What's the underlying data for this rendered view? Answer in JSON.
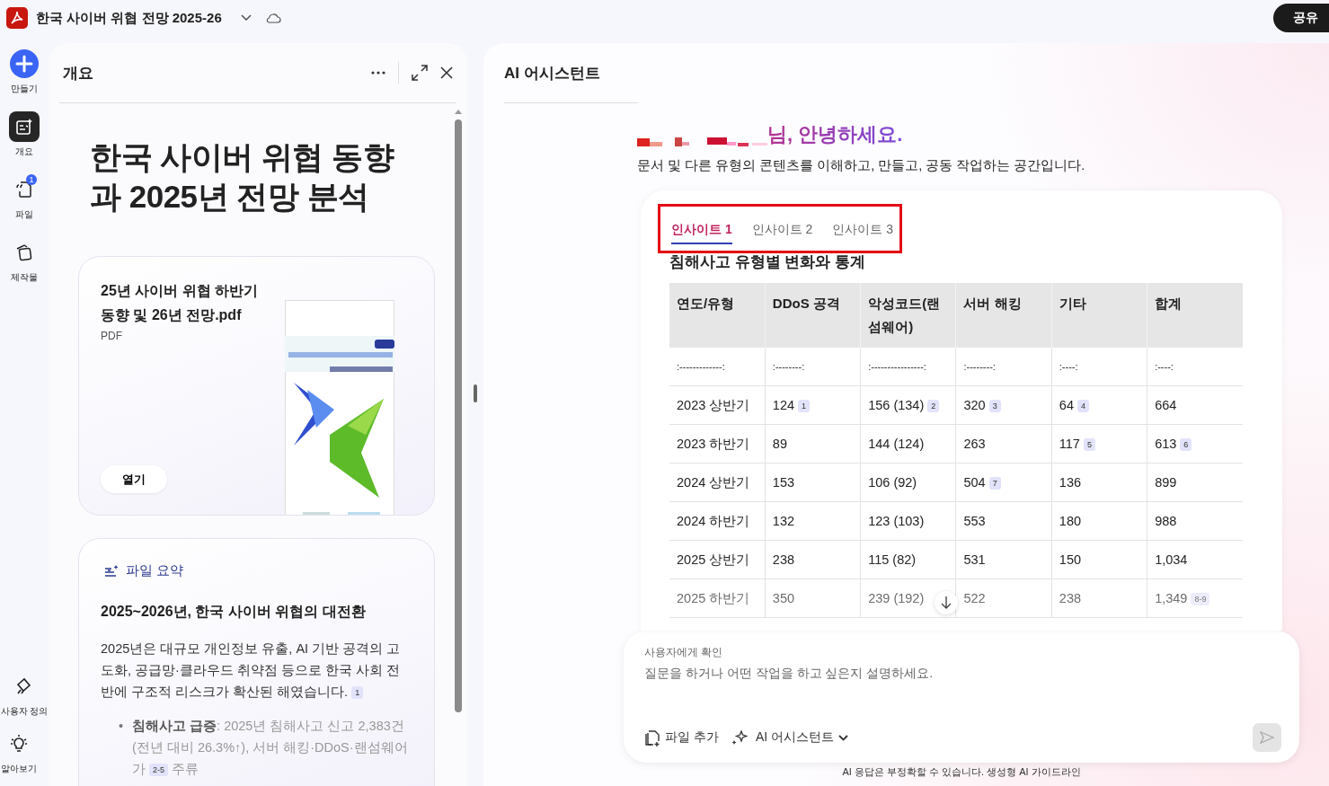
{
  "app": {
    "title": "한국 사이버 위협 전망 2025-26",
    "share_button": "공유"
  },
  "rail": {
    "top": [
      {
        "kind": "create",
        "label": "만들기",
        "selected": false
      },
      {
        "kind": "overview",
        "label": "개요",
        "selected": true
      },
      {
        "kind": "files",
        "label": "파일",
        "selected": false,
        "badge": "1"
      },
      {
        "kind": "outputs",
        "label": "제작물",
        "selected": false
      }
    ],
    "bottom": [
      {
        "kind": "customize",
        "label": "사용자 정의",
        "selected": false
      },
      {
        "kind": "learn",
        "label": "알아보기",
        "selected": false
      }
    ]
  },
  "overview": {
    "title": "개요",
    "heading": "한국 사이버 위협 동향과 2025년 전망 분석",
    "file_card": {
      "name": "25년 사이버 위협 하반기 동향 및 26년 전망.pdf",
      "type": "PDF",
      "open_button": "열기"
    },
    "summary": {
      "label": "파일 요약",
      "heading": "2025~2026년, 한국 사이버 위협의 대전환",
      "paragraph": {
        "text": "2025년은 대규모 개인정보 유출, AI 기반 공격의 고도화, 공급망·클라우드 취약점 등으로 한국 사회 전반에 구조적 리스크가 확산된 해였습니다.",
        "cite": "1"
      },
      "bullets": [
        {
          "marker": "•",
          "text": "**침해사고 급증**: 2025년 침해사고 신고 2,383건 (전년 대비 26.3%↑), 서버 해킹·DDoS·랜섬웨어가",
          "cite": "2-5",
          "tail": "주류"
        }
      ]
    }
  },
  "assistant": {
    "title": "AI 어시스턴트",
    "greeting": "님, 안녕하세요.",
    "intro": "문서 및 다른 유형의 콘텐츠를 이해하고, 만들고, 공동 작업하는 공간입니다.",
    "tabs": [
      {
        "label": "인사이트 1",
        "selected": true
      },
      {
        "label": "인사이트 2",
        "selected": false
      },
      {
        "label": "인사이트 3",
        "selected": false
      }
    ],
    "section_title": "침해사고 유형별 변화와 통계",
    "table": {
      "columns": [
        "연도/유형",
        "DDoS 공격",
        "악성코드(랜섬웨어)",
        "서버 해킹",
        "기타",
        "합계"
      ],
      "rows": [
        [
          {
            "text": ":-------------:"
          },
          {
            "text": ":--------:"
          },
          {
            "text": ":----------------:"
          },
          {
            "text": ":--------:"
          },
          {
            "text": ":----:"
          },
          {
            "text": ":----:"
          }
        ],
        [
          {
            "text": "2023 상반기"
          },
          {
            "text": "124",
            "cite": "1"
          },
          {
            "text": "156 (134)",
            "cite": "2"
          },
          {
            "text": "320",
            "cite": "3"
          },
          {
            "text": "64",
            "cite": "4"
          },
          {
            "text": "664"
          }
        ],
        [
          {
            "text": "2023 하반기"
          },
          {
            "text": "89"
          },
          {
            "text": "144 (124)"
          },
          {
            "text": "263"
          },
          {
            "text": "117",
            "cite": "5"
          },
          {
            "text": "613",
            "cite": "6"
          }
        ],
        [
          {
            "text": "2024 상반기"
          },
          {
            "text": "153"
          },
          {
            "text": "106 (92)"
          },
          {
            "text": "504",
            "cite": "7"
          },
          {
            "text": "136"
          },
          {
            "text": "899"
          }
        ],
        [
          {
            "text": "2024 하반기"
          },
          {
            "text": "132"
          },
          {
            "text": "123 (103)"
          },
          {
            "text": "553"
          },
          {
            "text": "180"
          },
          {
            "text": "988"
          }
        ],
        [
          {
            "text": "2025 상반기"
          },
          {
            "text": "238"
          },
          {
            "text": "115 (82)"
          },
          {
            "text": "531"
          },
          {
            "text": "150"
          },
          {
            "text": "1,034"
          }
        ],
        [
          {
            "text": "2025 하반기"
          },
          {
            "text": "350"
          },
          {
            "text": "239 (192)"
          },
          {
            "text": "522"
          },
          {
            "text": "238"
          },
          {
            "text": "1,349",
            "cite": "8-9"
          }
        ]
      ]
    },
    "composer": {
      "label": "사용자에게 확인",
      "placeholder": "질문을 하거나 어떤 작업을 하고 싶은지 설명하세요.",
      "add_file": "파일 추가",
      "mode": "AI 어시스턴트"
    },
    "disclaimer": "AI 응답은 부정확할 수 있습니다. 생성형 AI 가이드라인"
  }
}
